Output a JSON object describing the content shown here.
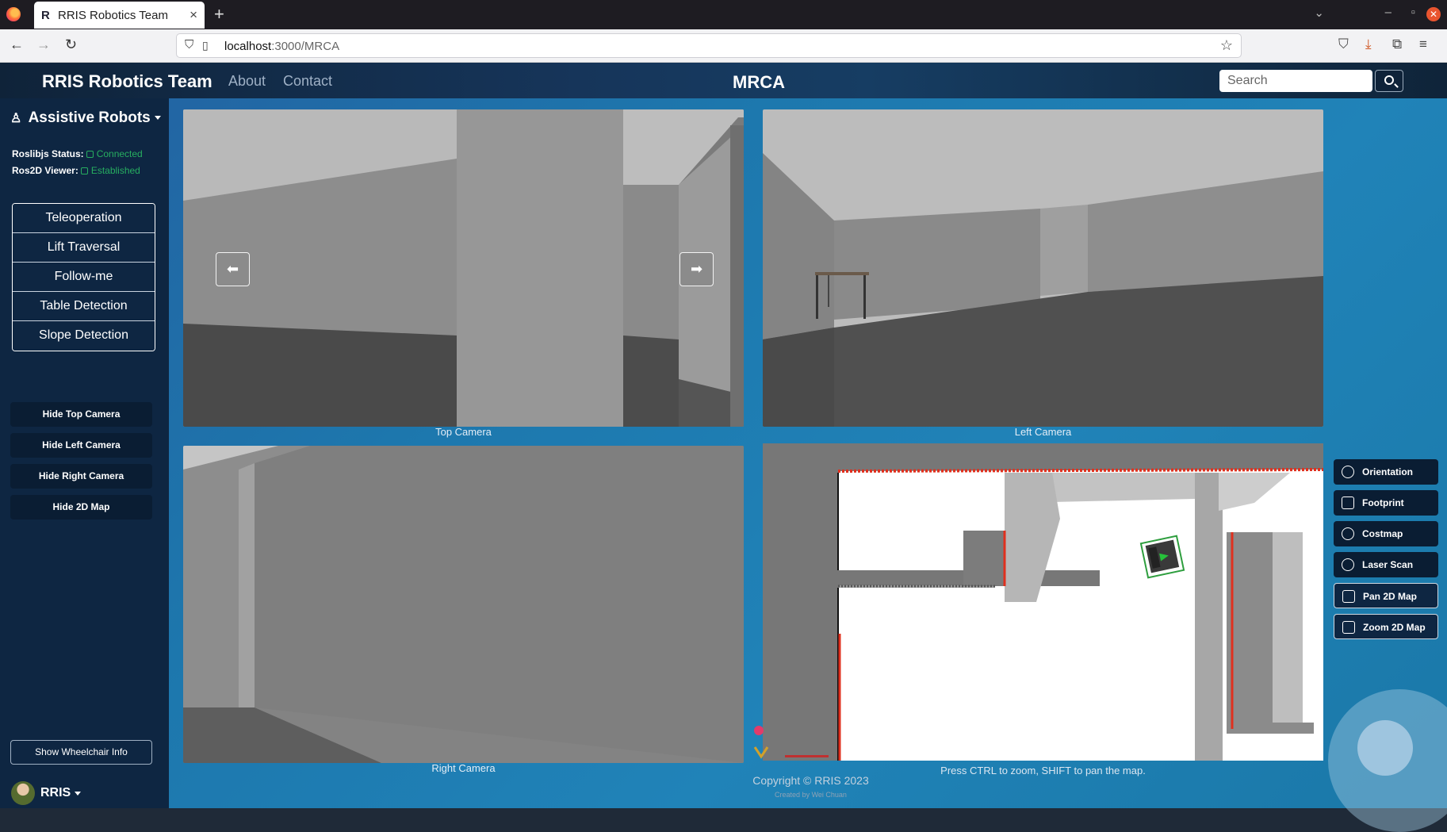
{
  "browser": {
    "tab_title": "RRIS Robotics Team",
    "tab_close": "×",
    "new_tab": "+",
    "url_host": "localhost",
    "url_path": ":3000/MRCA"
  },
  "header": {
    "brand": "RRIS Robotics Team",
    "nav": [
      "About",
      "Contact"
    ],
    "page_title": "MRCA",
    "search_placeholder": "Search"
  },
  "sidebar": {
    "robot_menu": "Assistive Robots",
    "statuses": [
      {
        "label": "Roslibjs Status:",
        "value": "Connected"
      },
      {
        "label": "Ros2D Viewer:",
        "value": "Established"
      }
    ],
    "modes": [
      "Teleoperation",
      "Lift Traversal",
      "Follow-me",
      "Table Detection",
      "Slope Detection"
    ],
    "camera_toggles": [
      "Hide Top Camera",
      "Hide Left Camera",
      "Hide Right Camera",
      "Hide 2D Map"
    ],
    "wheelchair_info": "Show Wheelchair Info",
    "user": "RRIS"
  },
  "cameras": {
    "top": "Top Camera",
    "left": "Left Camera",
    "right": "Right Camera",
    "prev_arrow": "⬅",
    "next_arrow": "➡"
  },
  "map": {
    "tools": [
      "Orientation",
      "Footprint",
      "Costmap",
      "Laser Scan",
      "Pan 2D Map",
      "Zoom 2D Map"
    ],
    "hint": "Press CTRL to zoom, SHIFT to pan the map."
  },
  "footer": {
    "copyright": "Copyright © RRIS 2023",
    "credit": "Created by Wei Chuan"
  },
  "colors": {
    "status_ok": "#27ae60",
    "sidebar_bg": "#0e2642",
    "laser": "#e0301e",
    "robot_footprint": "#2e9e3e"
  }
}
